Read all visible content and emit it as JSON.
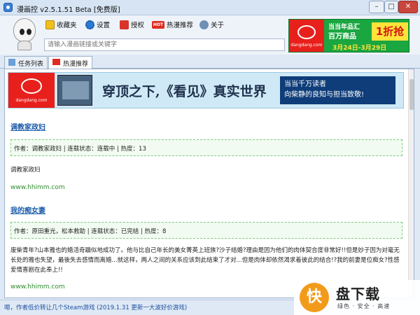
{
  "window": {
    "title": "漫画控 v2.5.1.51 Beta [免费版]",
    "min": "–",
    "max": "□",
    "close": "✕"
  },
  "toolbar": {
    "favorites": "收藏夹",
    "settings": "设置",
    "authorize": "授权",
    "hot_badge": "HOT",
    "hot": "热漫推荐",
    "about": "关于"
  },
  "search": {
    "placeholder": "请输入漫画链接或关键字"
  },
  "ad_top": {
    "logo_site": "dangdang.com",
    "line1": "当当年品汇",
    "line2": "百万商品",
    "big": "1折抢",
    "dates": "3月24日-3月29日"
  },
  "tabs": [
    {
      "label": "任务列表"
    },
    {
      "label": "热漫推荐"
    }
  ],
  "ad_banner": {
    "logo_site": "dangdang.com",
    "headline": "穿顶之下,《看见》真实世界",
    "side_line1": "当当千万读者",
    "side_line2": "向柴静的良知与担当致敬!"
  },
  "entries": [
    {
      "title": "调教家政妇",
      "meta": "作者：调教家政妇 | 连载状态：连载中 | 热度：13",
      "desc": "调教家政妇",
      "site": "www.hhimm.com"
    },
    {
      "title": "我的痴女妻",
      "meta": "作者：原田重光，松本救助 | 连载状态：已完结 | 热度：8",
      "desc": "废柴青年?山本雅也的婚活奇蹟似地成功了。他与比自己年长的美女菁英上班族?沙子结婚?理由是因为他们的肉体契合度非常好!!但是妙子因为对毫无长处的雅也失望，最後失去感情而离婚...就这样，两人之间的关系应该到此结束了才对...但是肉体却依然渴求着彼此的结合!?我的前妻是位痴女?性感爱情喜剧在此奉上!!",
      "site": "www.hhimm.com"
    }
  ],
  "status": {
    "text": "嗯，作者低价转让几个Steam游戏 (2019.1.31 更新一大波好价游戏)"
  },
  "watermark": {
    "glyph": "快",
    "name": "盘下载",
    "sub": "绿色 · 安全 · 高速"
  }
}
